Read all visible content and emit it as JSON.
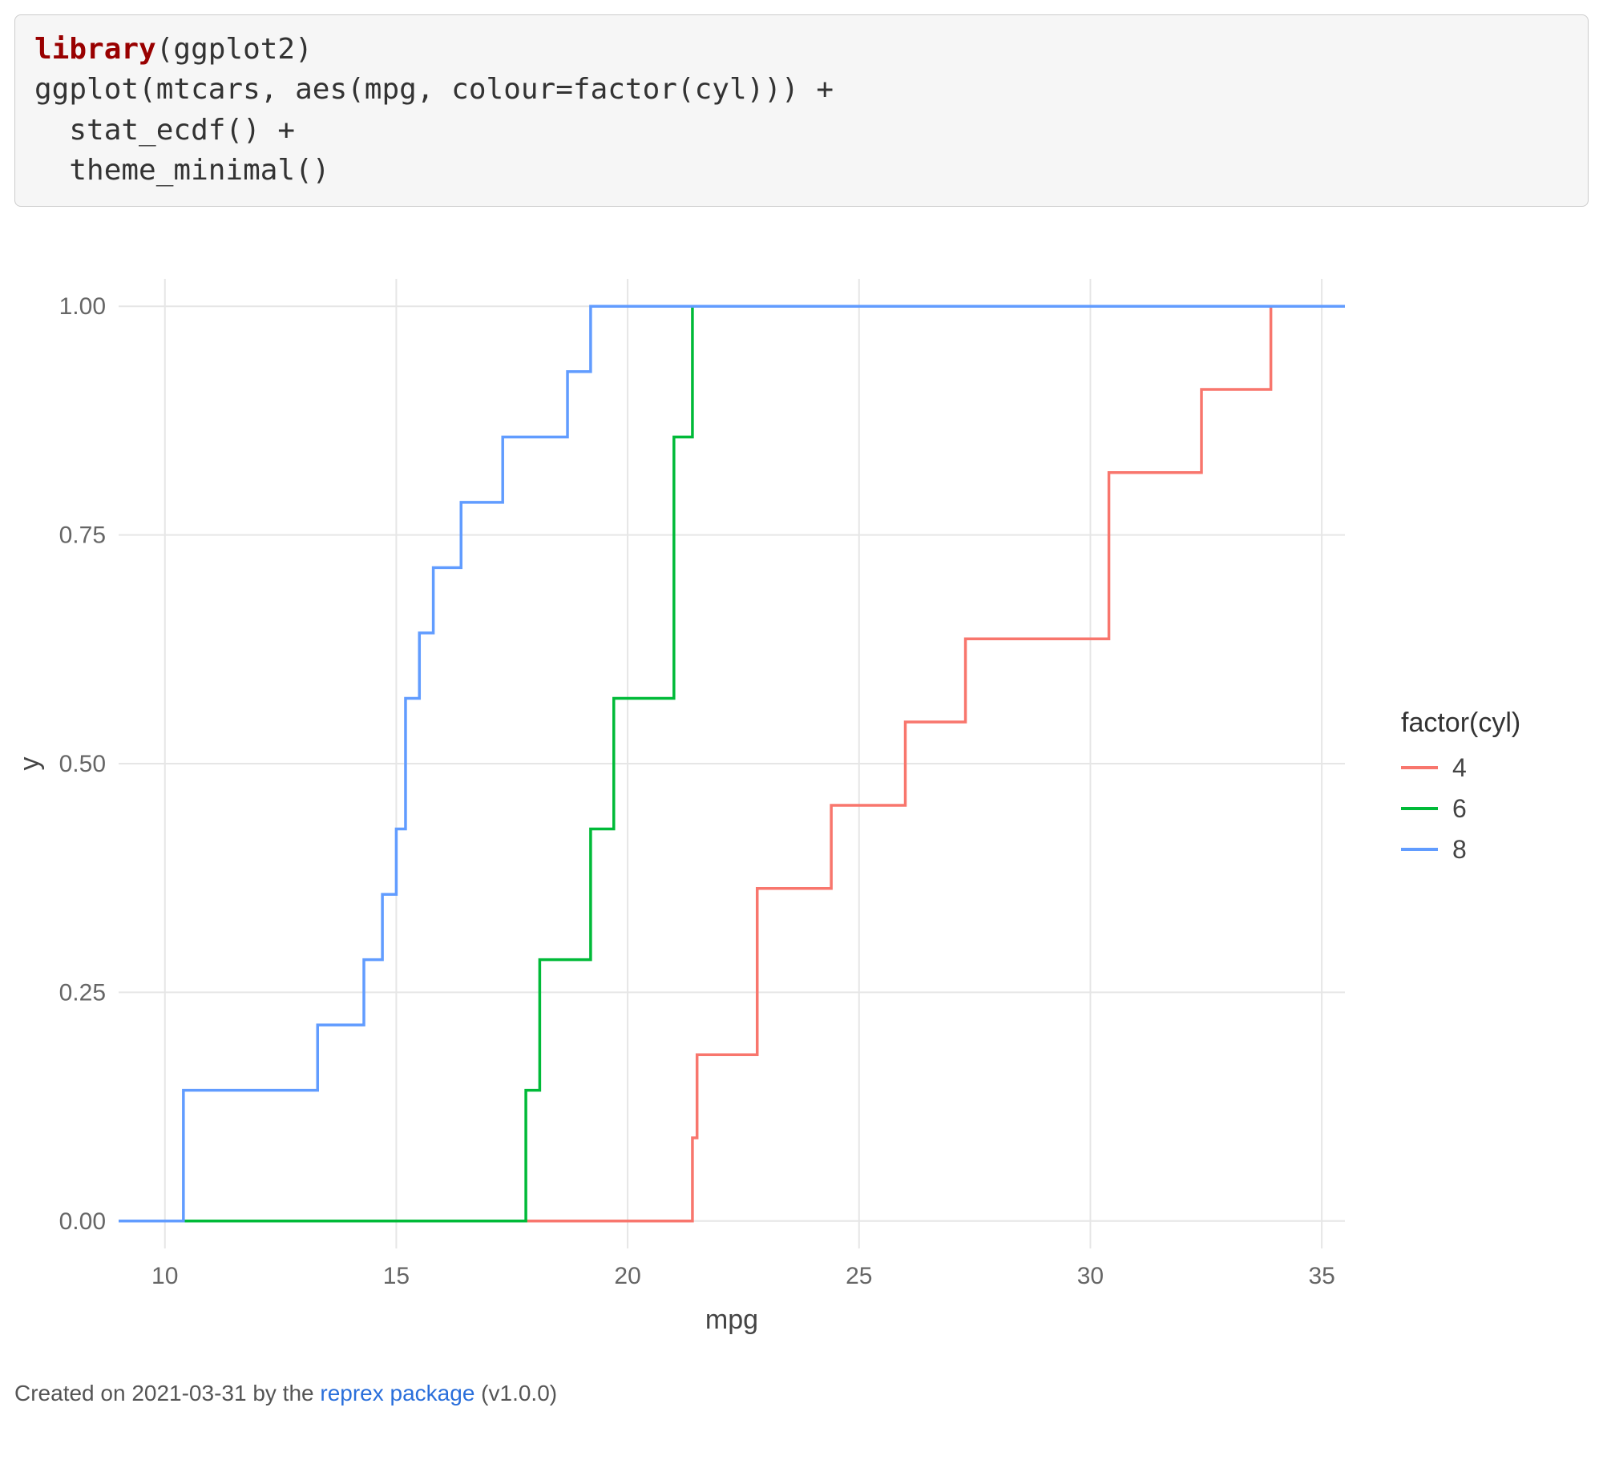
{
  "code": {
    "keyword": "library",
    "rest_line1": "(ggplot2)",
    "line2": "ggplot(mtcars, aes(mpg, colour=factor(cyl))) +",
    "line3": "  stat_ecdf() +",
    "line4": "  theme_minimal()"
  },
  "legend": {
    "title": "factor(cyl)",
    "items": [
      {
        "label": "4",
        "color": "#F8766D"
      },
      {
        "label": "6",
        "color": "#00BA38"
      },
      {
        "label": "8",
        "color": "#619CFF"
      }
    ]
  },
  "caption": {
    "prefix": "Created on 2021-03-31 by the ",
    "link_text": "reprex package",
    "suffix": " (v1.0.0)"
  },
  "chart_data": {
    "type": "line",
    "xlabel": "mpg",
    "ylabel": "y",
    "xlim": [
      9,
      35.5
    ],
    "ylim": [
      -0.03,
      1.03
    ],
    "x_ticks": [
      10,
      15,
      20,
      25,
      30,
      35
    ],
    "y_ticks": [
      0.0,
      0.25,
      0.5,
      0.75,
      1.0
    ],
    "y_tick_labels": [
      "0.00",
      "0.25",
      "0.50",
      "0.75",
      "1.00"
    ],
    "series": [
      {
        "name": "4",
        "color": "#F8766D",
        "steps": [
          {
            "x": 9.0,
            "y": 0.0
          },
          {
            "x": 21.4,
            "y": 0.0909
          },
          {
            "x": 21.5,
            "y": 0.1818
          },
          {
            "x": 22.8,
            "y": 0.3636
          },
          {
            "x": 24.4,
            "y": 0.4545
          },
          {
            "x": 26.0,
            "y": 0.5455
          },
          {
            "x": 27.3,
            "y": 0.6364
          },
          {
            "x": 30.4,
            "y": 0.8182
          },
          {
            "x": 32.4,
            "y": 0.9091
          },
          {
            "x": 33.9,
            "y": 1.0
          },
          {
            "x": 35.5,
            "y": 1.0
          }
        ]
      },
      {
        "name": "6",
        "color": "#00BA38",
        "steps": [
          {
            "x": 9.0,
            "y": 0.0
          },
          {
            "x": 17.8,
            "y": 0.1429
          },
          {
            "x": 18.1,
            "y": 0.2857
          },
          {
            "x": 19.2,
            "y": 0.4286
          },
          {
            "x": 19.7,
            "y": 0.5714
          },
          {
            "x": 21.0,
            "y": 0.8571
          },
          {
            "x": 21.4,
            "y": 1.0
          },
          {
            "x": 35.5,
            "y": 1.0
          }
        ]
      },
      {
        "name": "8",
        "color": "#619CFF",
        "steps": [
          {
            "x": 9.0,
            "y": 0.0
          },
          {
            "x": 10.4,
            "y": 0.1429
          },
          {
            "x": 13.3,
            "y": 0.2143
          },
          {
            "x": 14.3,
            "y": 0.2857
          },
          {
            "x": 14.7,
            "y": 0.3571
          },
          {
            "x": 15.0,
            "y": 0.4286
          },
          {
            "x": 15.2,
            "y": 0.5714
          },
          {
            "x": 15.5,
            "y": 0.6429
          },
          {
            "x": 15.8,
            "y": 0.7143
          },
          {
            "x": 16.4,
            "y": 0.7857
          },
          {
            "x": 17.3,
            "y": 0.8571
          },
          {
            "x": 18.7,
            "y": 0.9286
          },
          {
            "x": 19.2,
            "y": 1.0
          },
          {
            "x": 35.5,
            "y": 1.0
          }
        ]
      }
    ]
  }
}
